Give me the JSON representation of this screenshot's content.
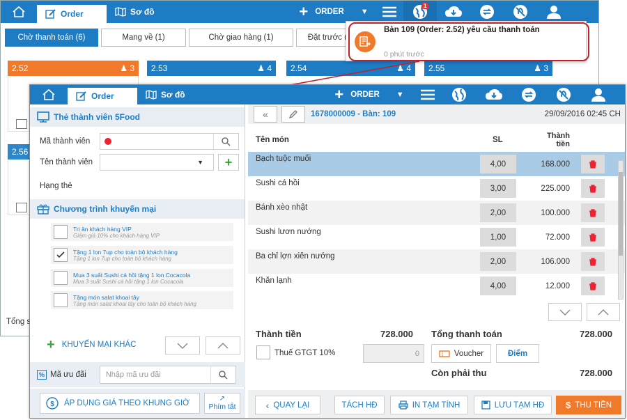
{
  "bg": {
    "tabs": {
      "order": "Order",
      "map": "Sơ đồ"
    },
    "order_label": "ORDER",
    "notif_badge": "1",
    "filters": [
      "Chờ thanh toán (6)",
      "Mang về (1)",
      "Chờ giao hàng (1)",
      "Đặt trước (0)"
    ],
    "cards": [
      {
        "table": "2.52",
        "guests": "3",
        "color": "#f07a2a"
      },
      {
        "table": "2.53",
        "guests": "4",
        "color": "#1d7cc4"
      },
      {
        "table": "2.54",
        "guests": "4",
        "color": "#1d7cc4"
      },
      {
        "table": "2.55",
        "guests": "3",
        "color": "#1d7cc4"
      }
    ],
    "card_partial": "2.56",
    "bottom_partial": "Tổng s"
  },
  "notification": {
    "title": "Bàn 109 (Order: 2.52) yêu cầu thanh toán",
    "time": "0 phút trước"
  },
  "win": {
    "tabs": {
      "order": "Order",
      "map": "Sơ đồ"
    },
    "order_label": "ORDER"
  },
  "left": {
    "member_title": "Thẻ thành viên 5Food",
    "member_code_label": "Mã thành viên",
    "member_name_label": "Tên thành viên",
    "card_rank_label": "Hạng thẻ",
    "promo_title": "Chương trình khuyến mại",
    "promos": [
      {
        "title": "Tri ân khách hàng VIP",
        "desc": "Giảm giá 10% cho khách hàng VIP",
        "checked": false
      },
      {
        "title": "Tặng 1 lon 7up cho toàn bộ khách hàng",
        "desc": "Tặng 1 lon 7up cho toàn bộ khách hàng",
        "checked": true
      },
      {
        "title": "Mua 3 suất Sushi cá hồi tặng 1 lon Cocacola",
        "desc": "Mua 3 suất Sushi cá hồi tặng 1 lon Cocacola",
        "checked": false
      },
      {
        "title": "Tặng món salat khoai tây",
        "desc": "Tặng món salat khoai tây cho toàn bộ khách hàng",
        "checked": false
      }
    ],
    "other_promo": "KHUYẾN MẠI KHÁC",
    "discount_label": "Mã ưu đãi",
    "discount_placeholder": "Nhập mã ưu đãi",
    "apply_price": "ÁP DỤNG GIÁ THEO KHUNG GIỜ",
    "shortcut": "Phím tắt"
  },
  "right": {
    "order_info": "1678000009 - Bàn: 109",
    "datetime": "29/09/2016 02:45 CH",
    "col_name": "Tên món",
    "col_qty": "SL",
    "col_amount": "Thành tiền",
    "items": [
      {
        "name": "Bạch tuộc muối",
        "qty": "4,00",
        "amount": "168.000"
      },
      {
        "name": "Sushi cá hồi",
        "qty": "3,00",
        "amount": "225.000"
      },
      {
        "name": "Bánh xèo nhật",
        "qty": "2,00",
        "amount": "100.000"
      },
      {
        "name": "Sushi lươn nướng",
        "qty": "1,00",
        "amount": "72.000"
      },
      {
        "name": "Ba chỉ lợn xiên nướng",
        "qty": "2,00",
        "amount": "106.000"
      },
      {
        "name": "Khăn lạnh",
        "qty": "4,00",
        "amount": "12.000"
      }
    ],
    "subtotal_label": "Thành tiền",
    "subtotal": "728.000",
    "vat_label": "Thuế GTGT 10%",
    "vat": "0",
    "grand_label": "Tổng thanh toán",
    "grand": "728.000",
    "voucher": "Voucher",
    "points": "Điểm",
    "remain_label": "Còn phải thu",
    "remain": "728.000",
    "btn_back": "QUAY LẠI",
    "btn_split": "TÁCH HĐ",
    "btn_print": "IN TẠM TÍNH",
    "btn_save": "LƯU TẠM HĐ",
    "btn_pay": "THU TIỀN"
  },
  "colors": {
    "primary": "#1d7cc4",
    "accent": "#f07a2a",
    "selected_row": "#a9cbe6",
    "annotation": "#c0202a"
  }
}
